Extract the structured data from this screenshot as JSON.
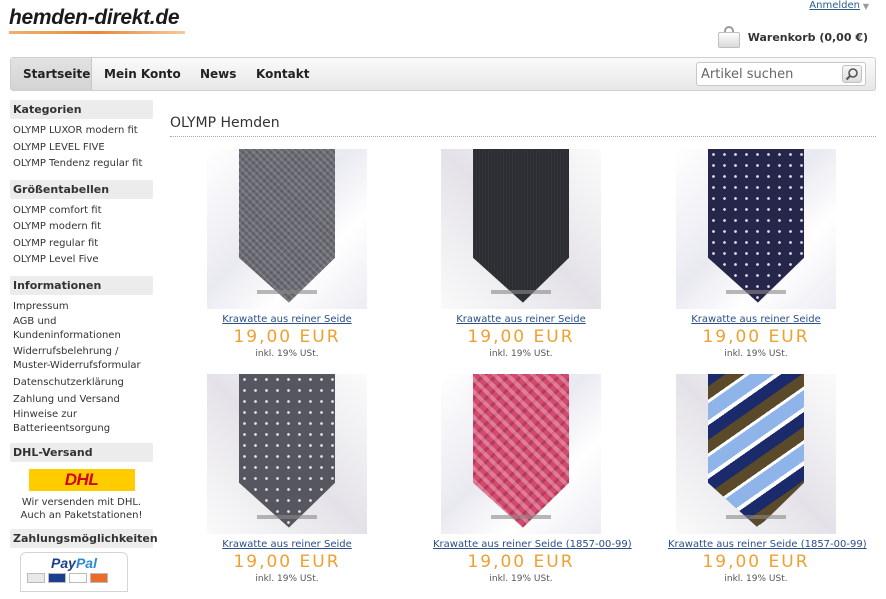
{
  "header": {
    "logo_text": "hemden-direkt.de",
    "login_link": "Anmelden",
    "cart_label": "Warenkorb (0,00 €)"
  },
  "nav": {
    "items": [
      "Startseite",
      "Mein Konto",
      "News",
      "Kontakt"
    ],
    "active": "Startseite",
    "search_placeholder": "Artikel suchen"
  },
  "sidebar": {
    "categories": {
      "title": "Kategorien",
      "links": [
        "OLYMP LUXOR modern fit",
        "OLYMP LEVEL FIVE",
        "OLYMP Tendenz regular fit"
      ]
    },
    "sizes": {
      "title": "Größentabellen",
      "links": [
        "OLYMP comfort fit",
        "OLYMP modern fit",
        "OLYMP regular fit",
        "OLYMP Level Five"
      ]
    },
    "info": {
      "title": "Informationen",
      "links": [
        "Impressum",
        "AGB und Kundeninformationen",
        "Widerrufsbelehrung / Muster-Widerrufsformular",
        "Datenschutzerklärung",
        "Zahlung und Versand",
        "Hinweise zur Batterieentsorgung"
      ]
    },
    "shipping": {
      "title": "DHL-Versand",
      "logo": "DHL",
      "text_line1": "Wir versenden mit DHL.",
      "text_line2": "Auch an Paketstationen!"
    },
    "payment": {
      "title": "Zahlungsmöglichkeiten",
      "logo_text_a": "Pay",
      "logo_text_b": "Pal"
    }
  },
  "main": {
    "heading": "OLYMP Hemden",
    "products": [
      {
        "name": "Krawatte aus reiner Seide",
        "price": "19,00 EUR",
        "tax": "inkl. 19% USt.",
        "tie_color": "#6a6a72",
        "pattern": "herringbone"
      },
      {
        "name": "Krawatte aus reiner Seide",
        "price": "19,00 EUR",
        "tax": "inkl. 19% USt.",
        "tie_color": "#2b2d33",
        "pattern": "solid"
      },
      {
        "name": "Krawatte aus reiner Seide",
        "price": "19,00 EUR",
        "tax": "inkl. 19% USt.",
        "tie_color": "#26264a",
        "pattern": "dots"
      },
      {
        "name": "Krawatte aus reiner Seide",
        "price": "19,00 EUR",
        "tax": "inkl. 19% USt.",
        "tie_color": "#55565e",
        "pattern": "dots"
      },
      {
        "name": "Krawatte aus reiner Seide (1857-00-99)",
        "price": "19,00 EUR",
        "tax": "inkl. 19% USt.",
        "tie_color": "#d24a6e",
        "pattern": "checks"
      },
      {
        "name": "Krawatte aus reiner Seide (1857-00-99)",
        "price": "19,00 EUR",
        "tax": "inkl. 19% USt.",
        "tie_color": "#3b5fc8",
        "pattern": "stripes"
      }
    ]
  },
  "colors": {
    "price": "#f0a030",
    "link": "#2a4f8a",
    "accent": "#e8893a"
  }
}
